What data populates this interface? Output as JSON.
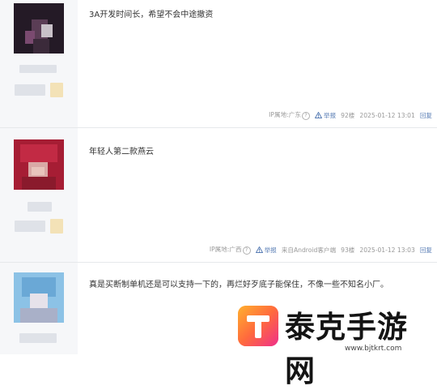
{
  "posts": [
    {
      "content": "3A开发时间长，希望不会中途撤资",
      "ip_label": "IP属地:广东",
      "report": "举报",
      "source": "",
      "floor": "92楼",
      "time": "2025-01-12 13:01",
      "reply": "回复"
    },
    {
      "content": "年轻人第二款燕云",
      "ip_label": "IP属地:广西",
      "report": "举报",
      "source": "来自Android客户端",
      "floor": "93楼",
      "time": "2025-01-12 13:03",
      "reply": "回复"
    },
    {
      "content": "真是买断制单机还是可以支持一下的，再烂好歹底子能保住，不像一些不知名小厂。"
    }
  ],
  "watermark": {
    "title": "泰克手游网",
    "url": "www.bjtkrt.com"
  },
  "colors": {
    "avatar1": "#2a1f2c",
    "avatar2": "#b0223a",
    "avatar3": "#8fc4e8",
    "link": "#5b7fb6"
  }
}
